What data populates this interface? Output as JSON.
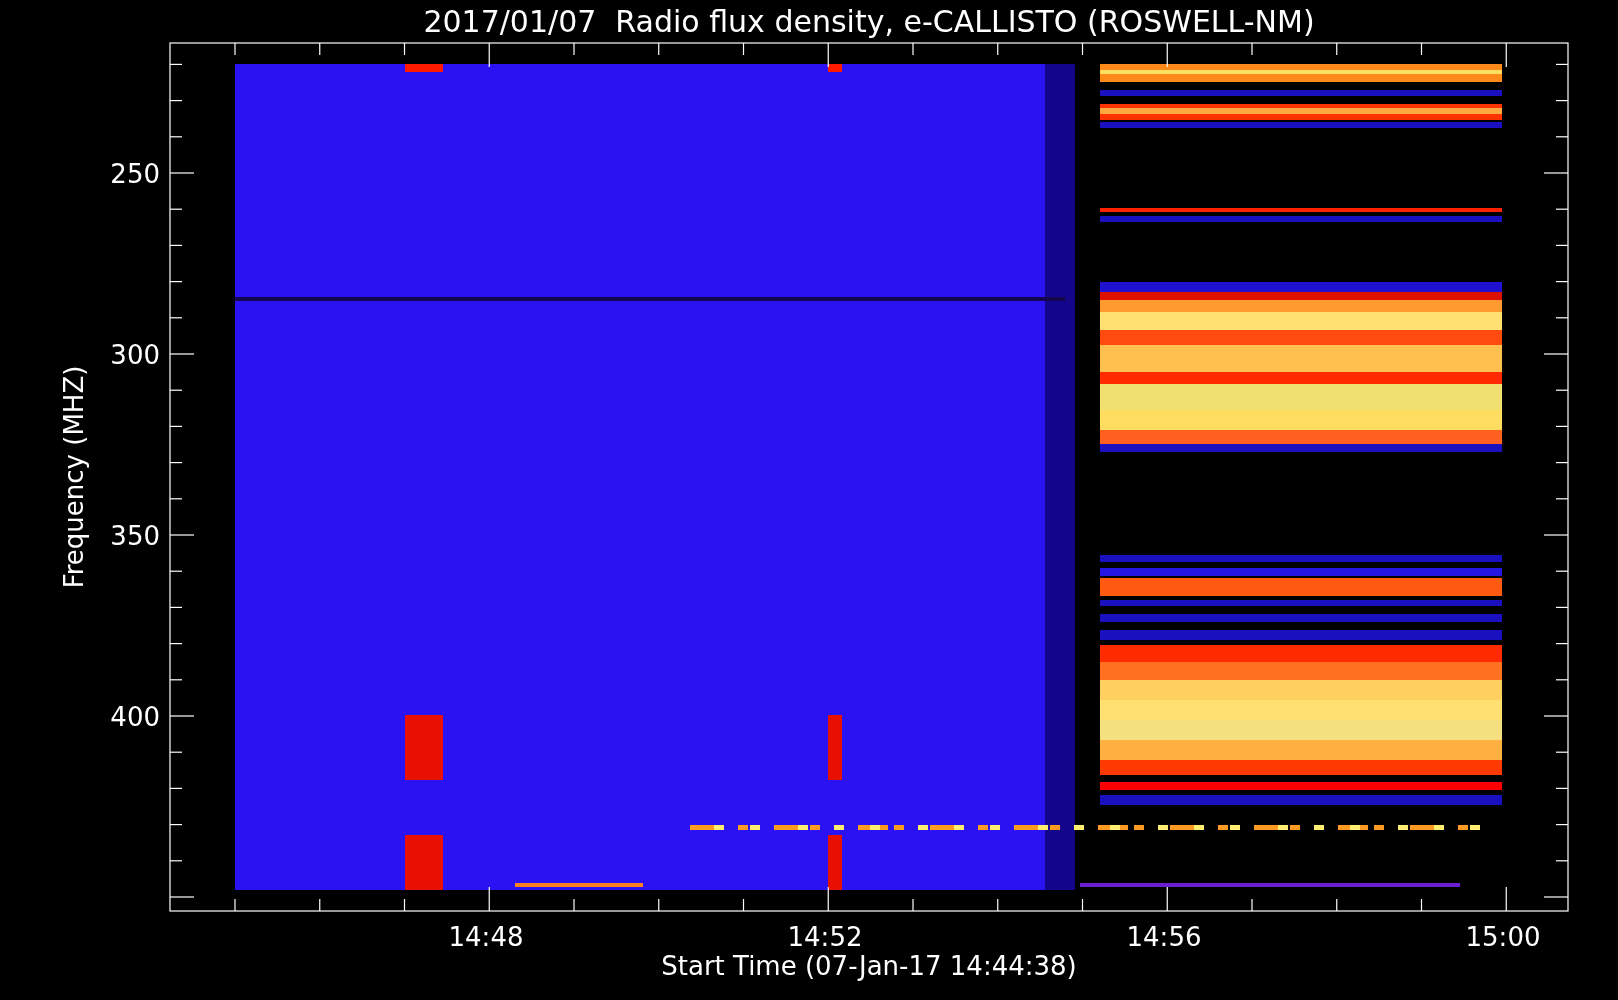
{
  "title": "2017/01/07  Radio flux density, e-CALLISTO (ROSWELL-NM)",
  "y_axis": {
    "label": "Frequency (MHZ)",
    "tick_labels": [
      "250",
      "300",
      "350",
      "400"
    ]
  },
  "x_axis": {
    "label": "Start Time (07-Jan-17 14:44:38)",
    "tick_labels": [
      "14:48",
      "14:52",
      "14:56",
      "15:00"
    ]
  }
}
